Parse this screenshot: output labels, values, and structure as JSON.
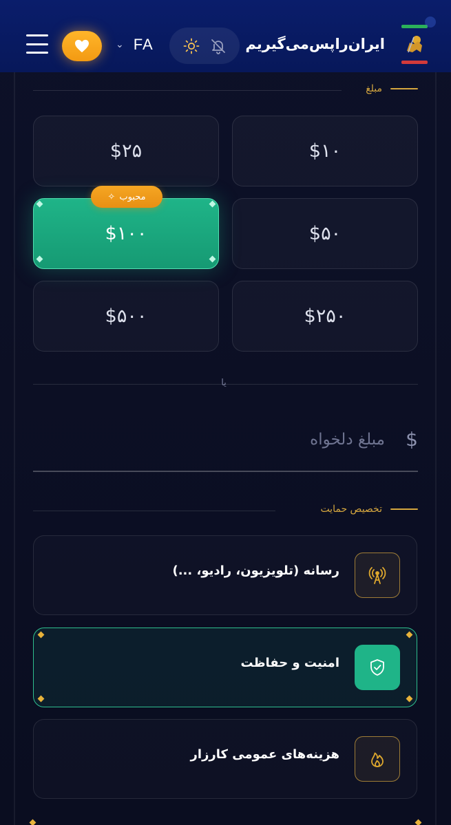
{
  "header": {
    "brand": "ایران‌راپس‌می‌گیریم",
    "language": "FA"
  },
  "amount_section": {
    "label": "مبلغ",
    "options": [
      "$۱۰",
      "$۲۵",
      "$۵۰",
      "$۱۰۰",
      "$۲۵۰",
      "$۵۰۰"
    ],
    "selected": "$۱۰۰",
    "popular_badge": "محبوب",
    "or_label": "یا",
    "custom_placeholder": "مبلغ دلخواه",
    "currency_symbol": "$"
  },
  "allocation_section": {
    "label": "تخصیص حمایت",
    "items": [
      {
        "label": "رسانه (تلویزیون، رادیو، ...)",
        "icon": "broadcast-icon"
      },
      {
        "label": "امنیت و حفاظت",
        "icon": "shield-check-icon"
      },
      {
        "label": "هزینه‌های عمومی کارزار",
        "icon": "flame-icon"
      }
    ],
    "selected": "امنیت و حفاظت"
  },
  "colors": {
    "accent_green": "#1fb488",
    "accent_gold": "#d7a83f",
    "header_blue": "#0a1d6b",
    "heart_orange": "#f5a623"
  }
}
